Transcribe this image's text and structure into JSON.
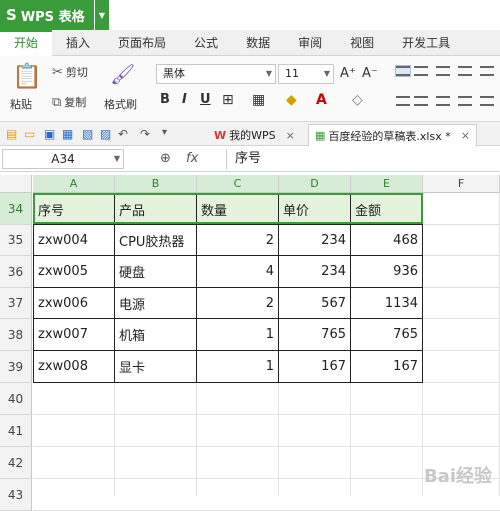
{
  "app": {
    "title": "WPS 表格",
    "logo": "S"
  },
  "ribbon_tabs": [
    "开始",
    "插入",
    "页面布局",
    "公式",
    "数据",
    "审阅",
    "视图",
    "开发工具"
  ],
  "ribbon": {
    "cut": "剪切",
    "paste": "粘贴",
    "copy": "复制",
    "format_painter": "格式刷",
    "font_name": "黑体",
    "font_size": "11",
    "grow": "A⁺",
    "shrink": "A⁻",
    "bold": "B",
    "italic": "I",
    "underline": "U"
  },
  "doc_tabs": [
    {
      "label": "我的WPS",
      "close": "×"
    },
    {
      "label": "百度经验的草稿表.xlsx *",
      "close": "×"
    }
  ],
  "formula_bar": {
    "name_box": "A34",
    "fx": "fx",
    "content": "序号"
  },
  "columns": [
    "A",
    "B",
    "C",
    "D",
    "E",
    "F"
  ],
  "rows": [
    "34",
    "35",
    "36",
    "37",
    "38",
    "39",
    "40",
    "41",
    "42",
    "43"
  ],
  "table": {
    "header": [
      "序号",
      "产品",
      "数量",
      "单价",
      "金额"
    ],
    "rows": [
      [
        "zxw004",
        "CPU胶热器",
        "2",
        "234",
        "468"
      ],
      [
        "zxw005",
        "硬盘",
        "4",
        "234",
        "936"
      ],
      [
        "zxw006",
        "电源",
        "2",
        "567",
        "1134"
      ],
      [
        "zxw007",
        "机箱",
        "1",
        "765",
        "765"
      ],
      [
        "zxw008",
        "显卡",
        "1",
        "167",
        "167"
      ]
    ]
  },
  "colors": {
    "accent": "#3a9b3a",
    "header_fill": "#e5f2dc"
  },
  "watermark": "Bai经验"
}
